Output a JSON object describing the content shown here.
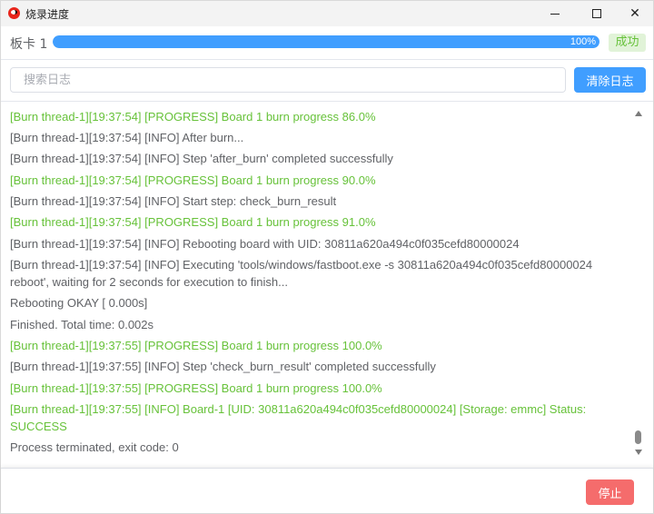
{
  "window": {
    "title": "烧录进度",
    "icons": {
      "app": "app-logo-icon",
      "minimize": "minimize-icon",
      "maximize": "maximize-icon",
      "close": "close-icon"
    },
    "close_glyph": "✕"
  },
  "board": {
    "label": "板卡 1",
    "progress_value": 100,
    "progress_text": "100%",
    "status": "成功"
  },
  "search": {
    "placeholder": "搜索日志",
    "value": ""
  },
  "buttons": {
    "clear_log": "清除日志",
    "stop": "停止"
  },
  "colors": {
    "primary": "#409eff",
    "success_text": "#67c23a",
    "success_bg": "#e1f3d8",
    "danger": "#f56c6c",
    "log_text": "#606266"
  },
  "log": {
    "lines": [
      {
        "level": "progress",
        "text": "[Burn thread-1][19:37:54] [PROGRESS] Board 1 burn progress 86.0%"
      },
      {
        "level": "info",
        "text": "[Burn thread-1][19:37:54] [INFO] After burn..."
      },
      {
        "level": "info",
        "text": "[Burn thread-1][19:37:54] [INFO] Step 'after_burn' completed successfully"
      },
      {
        "level": "progress",
        "text": "[Burn thread-1][19:37:54] [PROGRESS] Board 1 burn progress 90.0%"
      },
      {
        "level": "info",
        "text": "[Burn thread-1][19:37:54] [INFO] Start step: check_burn_result"
      },
      {
        "level": "progress",
        "text": "[Burn thread-1][19:37:54] [PROGRESS] Board 1 burn progress 91.0%"
      },
      {
        "level": "info",
        "text": "[Burn thread-1][19:37:54] [INFO] Rebooting board with UID: 30811a620a494c0f035cefd80000024"
      },
      {
        "level": "info",
        "text": "[Burn thread-1][19:37:54] [INFO] Executing 'tools/windows/fastboot.exe -s 30811a620a494c0f035cefd80000024 reboot', waiting for 2 seconds for execution to finish..."
      },
      {
        "level": "info",
        "text": "Rebooting OKAY [ 0.000s]"
      },
      {
        "level": "info",
        "text": "Finished. Total time: 0.002s"
      },
      {
        "level": "progress",
        "text": "[Burn thread-1][19:37:55] [PROGRESS] Board 1 burn progress 100.0%"
      },
      {
        "level": "info",
        "text": "[Burn thread-1][19:37:55] [INFO] Step 'check_burn_result' completed successfully"
      },
      {
        "level": "progress",
        "text": "[Burn thread-1][19:37:55] [PROGRESS] Board 1 burn progress 100.0%"
      },
      {
        "level": "progress",
        "text": "[Burn thread-1][19:37:55] [INFO] Board-1 [UID: 30811a620a494c0f035cefd80000024] [Storage: emmc] Status: SUCCESS"
      },
      {
        "level": "info",
        "text": "Process terminated, exit code: 0"
      }
    ]
  }
}
